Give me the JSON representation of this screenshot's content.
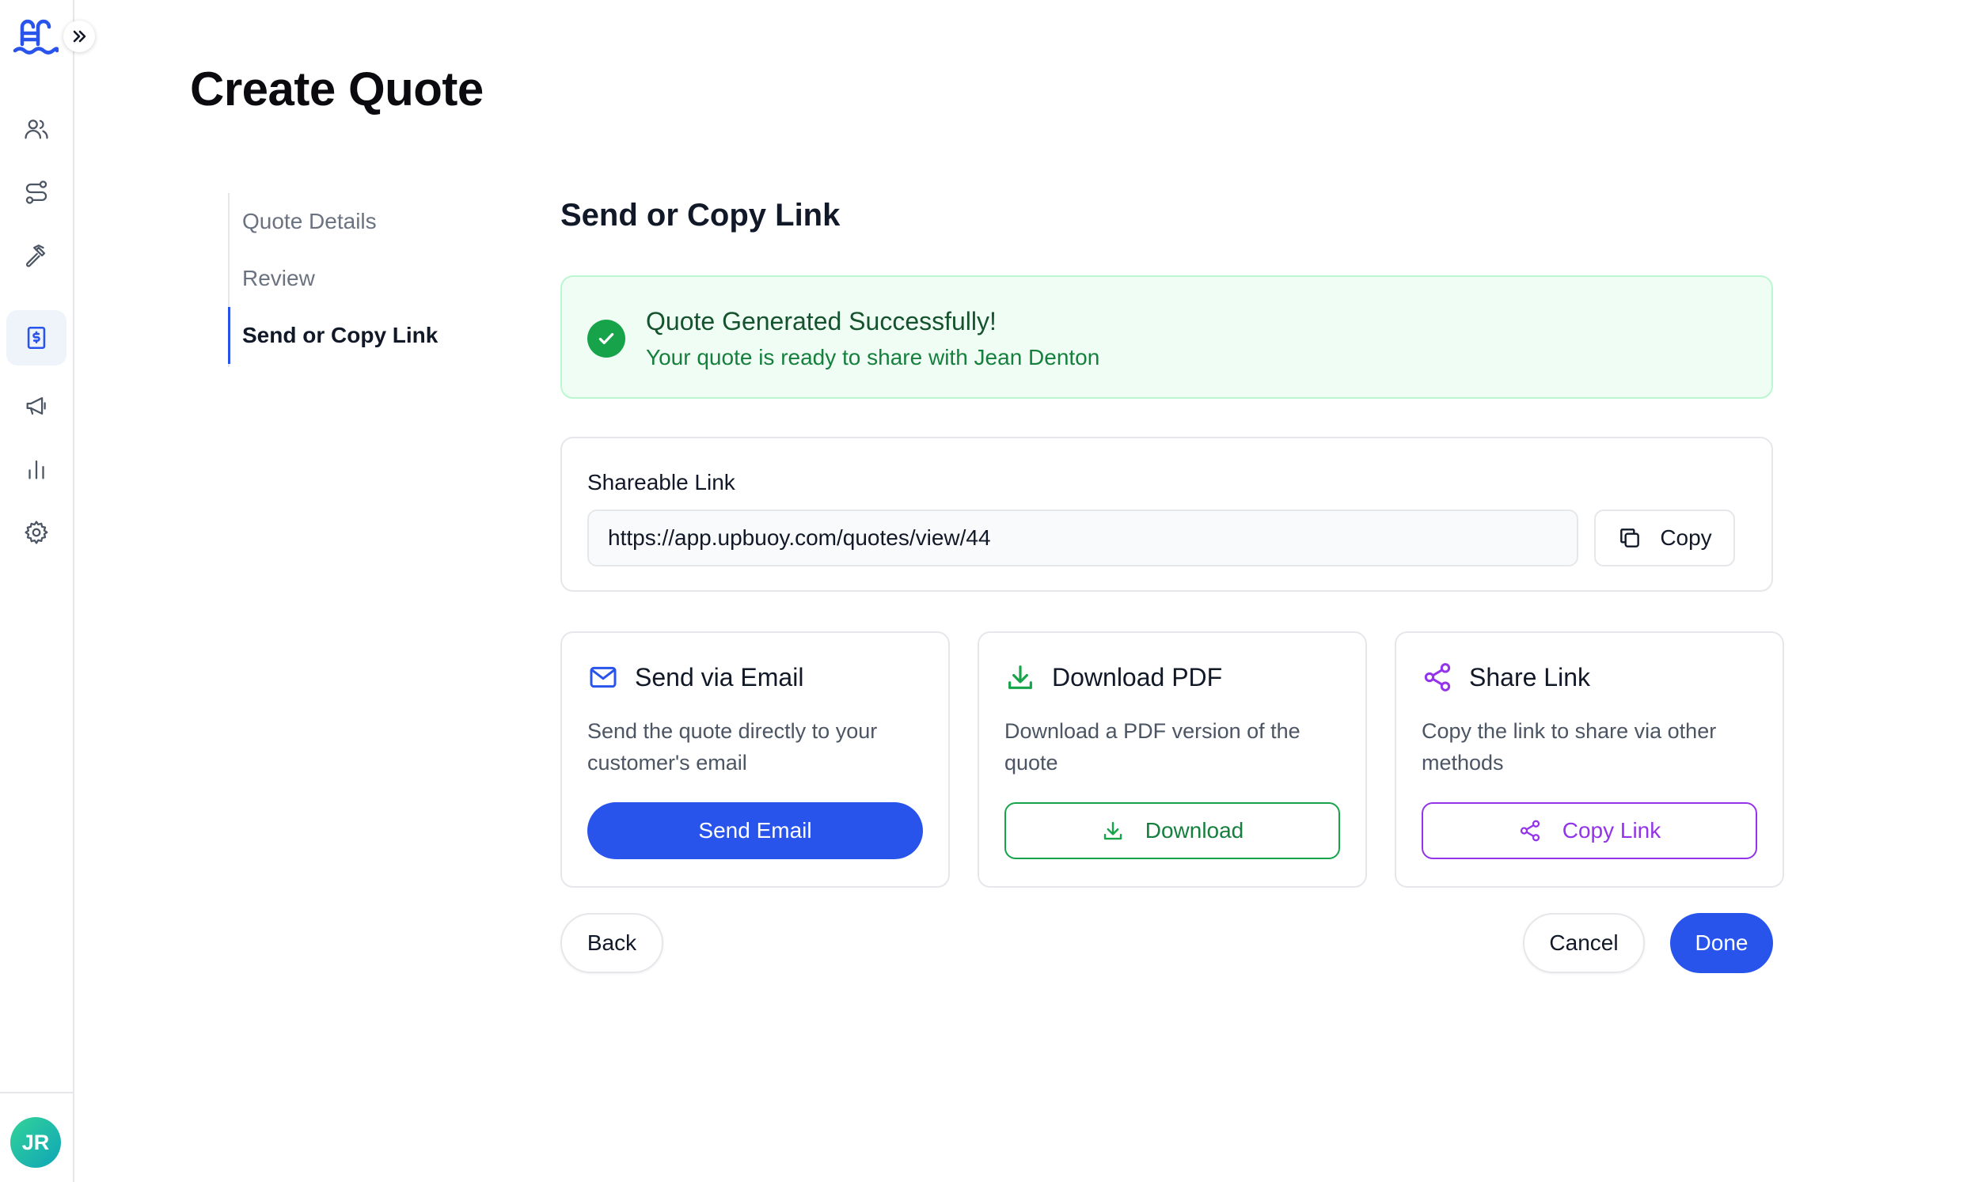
{
  "app": {
    "accent": "#2854ec",
    "success_color": "#16a34a",
    "purple_color": "#9333ea"
  },
  "sidebar": {
    "logo_icon": "pool-ladder-logo-icon",
    "expand_icon": "chevrons-right-icon",
    "items": [
      {
        "icon": "users-icon"
      },
      {
        "icon": "route-icon"
      },
      {
        "icon": "hammer-icon"
      },
      {
        "icon": "invoice-dollar-icon",
        "active": true
      },
      {
        "icon": "megaphone-icon"
      },
      {
        "icon": "bar-chart-icon"
      },
      {
        "icon": "gear-icon"
      }
    ],
    "avatar_initials": "JR"
  },
  "page": {
    "title": "Create Quote"
  },
  "steps": [
    {
      "label": "Quote Details"
    },
    {
      "label": "Review"
    },
    {
      "label": "Send or Copy Link",
      "active": true
    }
  ],
  "main": {
    "section_title": "Send or Copy Link",
    "success": {
      "title": "Quote Generated Successfully!",
      "message": "Your quote is ready to share with Jean Denton"
    },
    "shareable": {
      "label": "Shareable Link",
      "url": "https://app.upbuoy.com/quotes/view/44",
      "copy_label": "Copy"
    },
    "options": [
      {
        "icon": "mail-icon",
        "title": "Send via Email",
        "description": "Send the quote directly to your customer's email",
        "button": "Send Email"
      },
      {
        "icon": "download-icon",
        "title": "Download PDF",
        "description": "Download a PDF version of the quote",
        "button": "Download"
      },
      {
        "icon": "share-icon",
        "title": "Share Link",
        "description": "Copy the link to share via other methods",
        "button": "Copy Link"
      }
    ],
    "footer": {
      "back": "Back",
      "cancel": "Cancel",
      "done": "Done"
    }
  }
}
